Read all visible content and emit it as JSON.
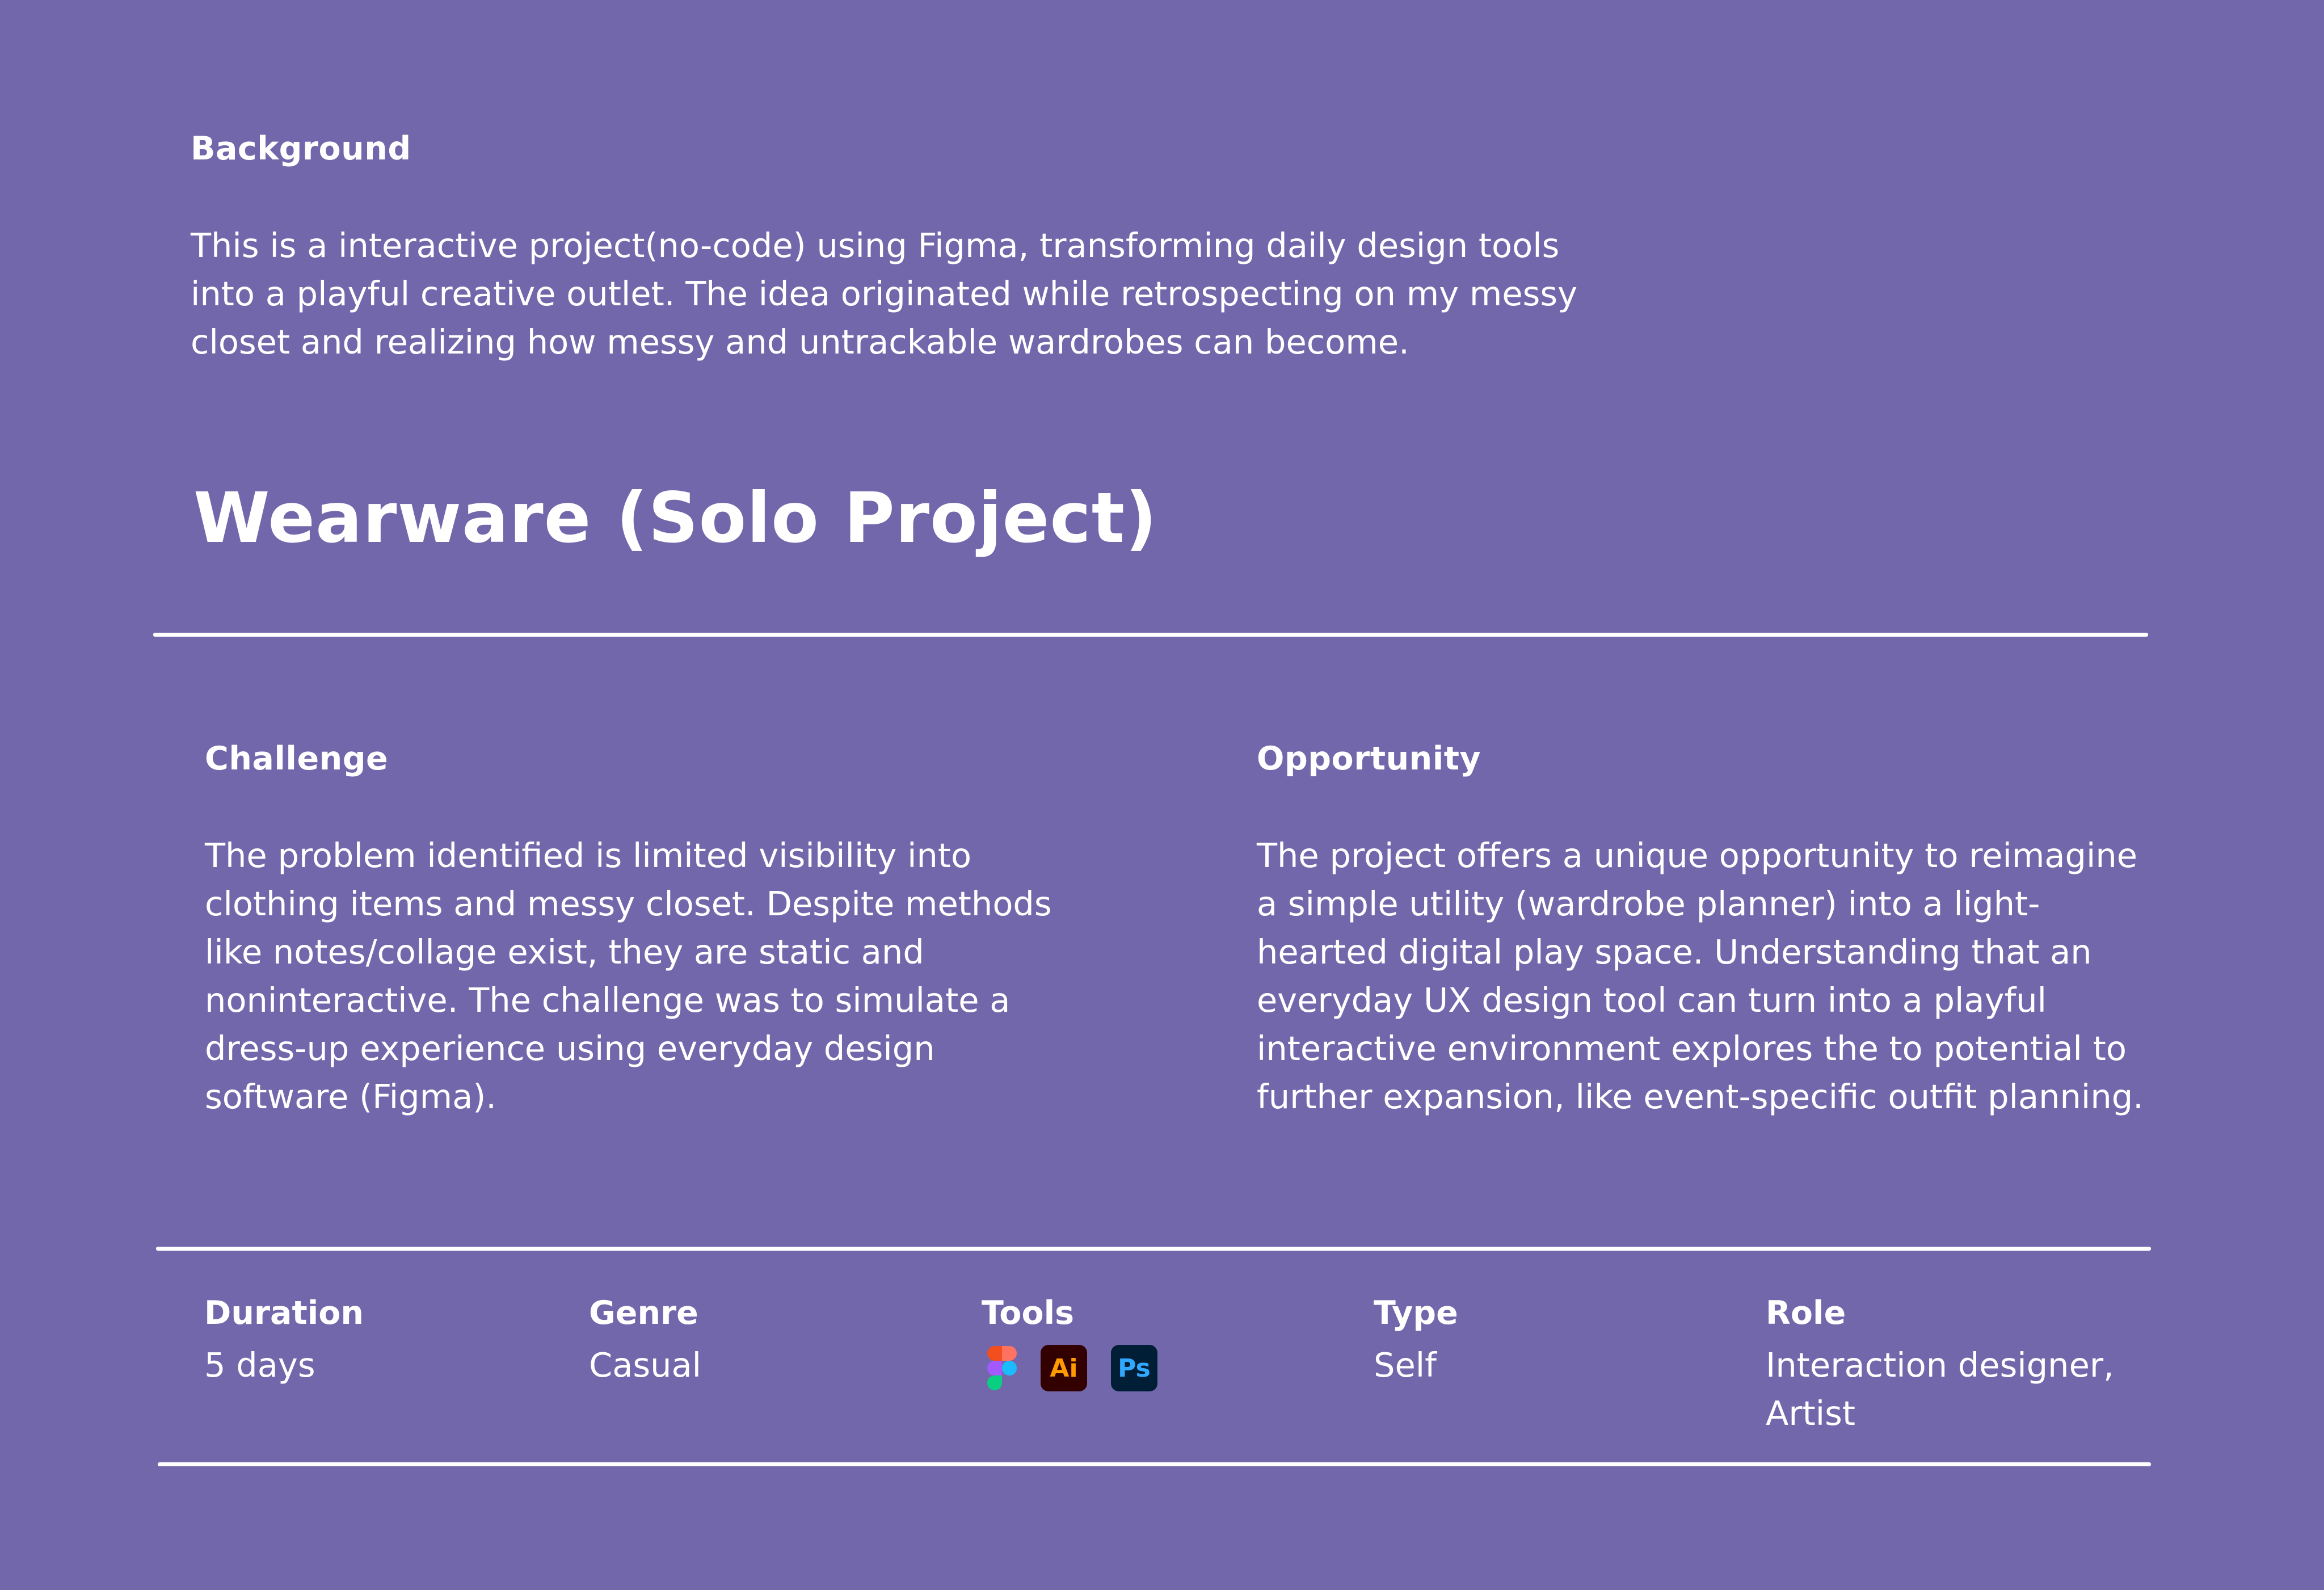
{
  "background": {
    "label": "Background",
    "text": "This is a interactive project(no-code) using Figma, transforming daily design tools into a playful creative outlet. The idea originated while retrospecting on my messy closet and realizing how messy and untrackable wardrobes can become."
  },
  "project": {
    "title": "Wearware (Solo Project)"
  },
  "challenge": {
    "label": "Challenge",
    "text": "The problem identified is limited visibility into clothing items and messy closet. Despite methods like notes/collage exist, they are static and noninteractive. The challenge was to simulate a dress-up experience using everyday design software (Figma)."
  },
  "opportunity": {
    "label": "Opportunity",
    "text": "The project offers a unique opportunity to reimagine a simple utility (wardrobe planner) into a light-hearted digital play space. Understanding that an everyday UX design tool can turn into a playful interactive environment explores the to potential to further expansion, like event-specific outfit planning."
  },
  "meta": {
    "duration": {
      "label": "Duration",
      "value": "5 days"
    },
    "genre": {
      "label": "Genre",
      "value": "Casual"
    },
    "tools": {
      "label": "Tools",
      "icons": [
        "figma-icon",
        "illustrator-icon",
        "photoshop-icon"
      ],
      "illustrator_text": "Ai",
      "photoshop_text": "Ps"
    },
    "type": {
      "label": "Type",
      "value": "Self"
    },
    "role": {
      "label": "Role",
      "value": "Interaction designer, Artist"
    }
  },
  "colors": {
    "background": "#7367ab",
    "text": "#ffffff",
    "illustrator_bg": "#330000",
    "illustrator_fg": "#ff9a00",
    "photoshop_bg": "#001e36",
    "photoshop_fg": "#31a8ff"
  }
}
